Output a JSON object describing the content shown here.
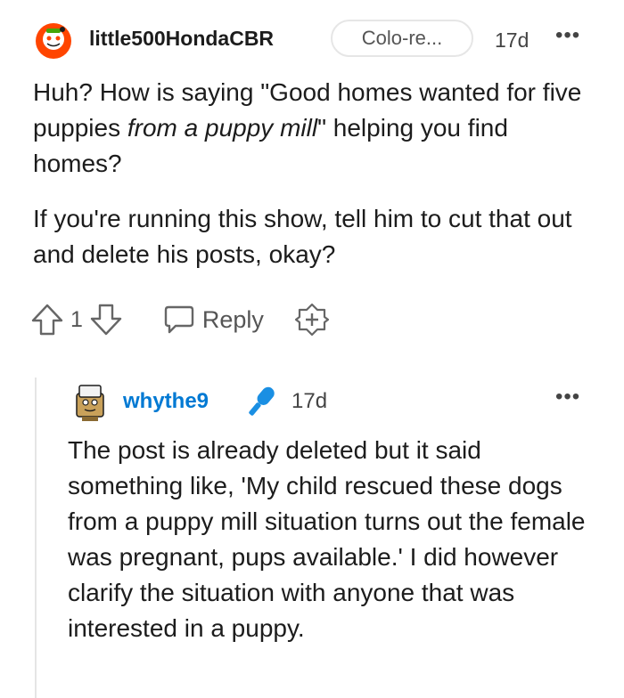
{
  "comment": {
    "username": "little500HondaCBR",
    "flair": "Colo-re...",
    "time": "17d",
    "more": "•••",
    "body_p1_start": "Huh? How is saying \"Good homes wanted for five puppies ",
    "body_p1_em": "from a puppy mill",
    "body_p1_end": "\" helping you find homes?",
    "body_p2": "If you're running this show, tell him to cut that out and delete his posts, okay?",
    "votes": "1",
    "reply_label": "Reply"
  },
  "reply": {
    "username": "whythe9",
    "time": "17d",
    "more": "•••",
    "body": "The post is already deleted but it said something like, 'My child rescued these dogs from a puppy mill situation turns out the female was pregnant, pups available.' I did however clarify the situation with anyone that was interested in a puppy."
  },
  "icons": {
    "avatar1": "snoo-avatar-icon",
    "avatar2": "user-avatar-icon",
    "mic": "microphone-icon",
    "upvote": "upvote-arrow-icon",
    "downvote": "downvote-arrow-icon",
    "reply": "speech-bubble-icon",
    "award": "award-plus-icon"
  },
  "colors": {
    "username_link": "#0079d3",
    "snoo_orange": "#ff4500",
    "mic_blue": "#1a8fe3"
  }
}
